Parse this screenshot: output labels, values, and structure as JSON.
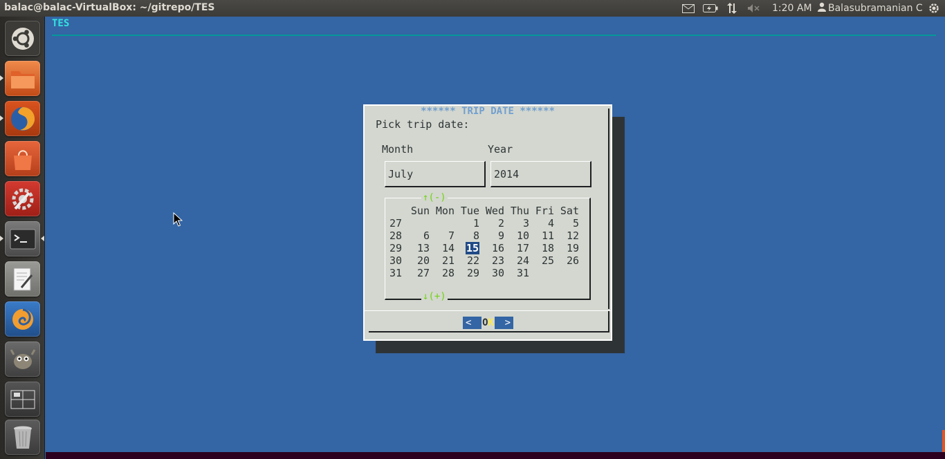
{
  "topbar": {
    "window_title": "balac@balac-VirtualBox: ~/gitrepo/TES",
    "clock": "1:20 AM",
    "user": "Balasubramanian C",
    "icons": [
      "mail-icon",
      "battery-icon",
      "network-icon",
      "volume-muted-icon",
      "gear-icon"
    ]
  },
  "launcher": {
    "items": [
      {
        "name": "ubuntu-dash",
        "icon": "ubuntu-logo-icon"
      },
      {
        "name": "files",
        "icon": "folder-icon"
      },
      {
        "name": "firefox",
        "icon": "firefox-icon"
      },
      {
        "name": "software-center",
        "icon": "shopping-bag-icon"
      },
      {
        "name": "system-settings",
        "icon": "settings-wrench-icon"
      },
      {
        "name": "terminal",
        "icon": "terminal-icon"
      },
      {
        "name": "text-editor",
        "icon": "text-editor-icon"
      },
      {
        "name": "blender",
        "icon": "swirl-icon"
      },
      {
        "name": "gimp",
        "icon": "gimp-icon"
      },
      {
        "name": "workspace-switcher",
        "icon": "workspace-icon"
      },
      {
        "name": "trash",
        "icon": "trash-icon"
      }
    ]
  },
  "terminal": {
    "app_title": "TES"
  },
  "dialog": {
    "title": "****** TRIP DATE ******",
    "prompt": "Pick trip date:",
    "month_label": "Month",
    "year_label": "Year",
    "month_value": "July",
    "year_value": "2014",
    "scroll_up": "↑(-)",
    "scroll_down": "↓(+)",
    "calendar": {
      "header": [
        "Sun",
        "Mon",
        "Tue",
        "Wed",
        "Thu",
        "Fri",
        "Sat"
      ],
      "weeks": [
        {
          "week": "27",
          "days": [
            "",
            "",
            "1",
            "2",
            "3",
            "4",
            "5"
          ]
        },
        {
          "week": "28",
          "days": [
            "6",
            "7",
            "8",
            "9",
            "10",
            "11",
            "12"
          ]
        },
        {
          "week": "29",
          "days": [
            "13",
            "14",
            "15",
            "16",
            "17",
            "18",
            "19"
          ]
        },
        {
          "week": "30",
          "days": [
            "20",
            "21",
            "22",
            "23",
            "24",
            "25",
            "26"
          ]
        },
        {
          "week": "31",
          "days": [
            "27",
            "28",
            "29",
            "30",
            "31",
            "",
            ""
          ]
        }
      ],
      "selected_day": "15"
    },
    "ok_button": {
      "left": "<",
      "label_o": "O",
      "label_k": "K",
      "right": ">"
    }
  },
  "colors": {
    "desktop_bg": "#3465a4",
    "dialog_bg": "#d3d7cf",
    "accent_cyan": "#34e2e2",
    "arrow_green": "#73d216",
    "title_blue": "#729fcf"
  }
}
